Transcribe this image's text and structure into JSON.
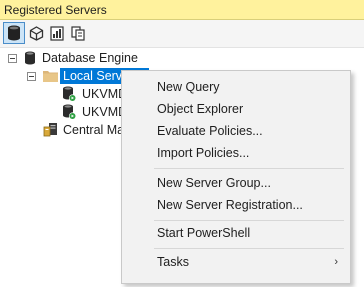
{
  "window": {
    "title": "Registered Servers"
  },
  "toolbar": {
    "buttons": [
      {
        "icon": "database-engine-icon",
        "active": true
      },
      {
        "icon": "analysis-services-icon",
        "active": false
      },
      {
        "icon": "reporting-services-icon",
        "active": false
      },
      {
        "icon": "integration-services-icon",
        "active": false
      }
    ]
  },
  "tree": {
    "root": {
      "label": "Database Engine",
      "icon": "database-icon"
    },
    "group": {
      "label": "Local Server G",
      "icon": "folder-icon",
      "selected": true
    },
    "servers": [
      {
        "label": "UKVMD",
        "icon": "server-registered-icon"
      },
      {
        "label": "UKVMD",
        "icon": "server-registered-icon"
      }
    ],
    "central": {
      "label": "Central Ma",
      "icon": "central-management-server-icon"
    }
  },
  "context_menu": {
    "items": [
      {
        "label": "New Query"
      },
      {
        "label": "Object Explorer"
      },
      {
        "label": "Evaluate Policies..."
      },
      {
        "label": "Import Policies..."
      },
      {
        "label": "New Server Group..."
      },
      {
        "label": "New Server Registration..."
      },
      {
        "label": "Start PowerShell"
      },
      {
        "label": "Tasks",
        "submenu": true
      }
    ]
  },
  "colors": {
    "title_bar": "#fff29d",
    "selection": "#0078d7",
    "menu_bg": "#f2f2f2"
  }
}
